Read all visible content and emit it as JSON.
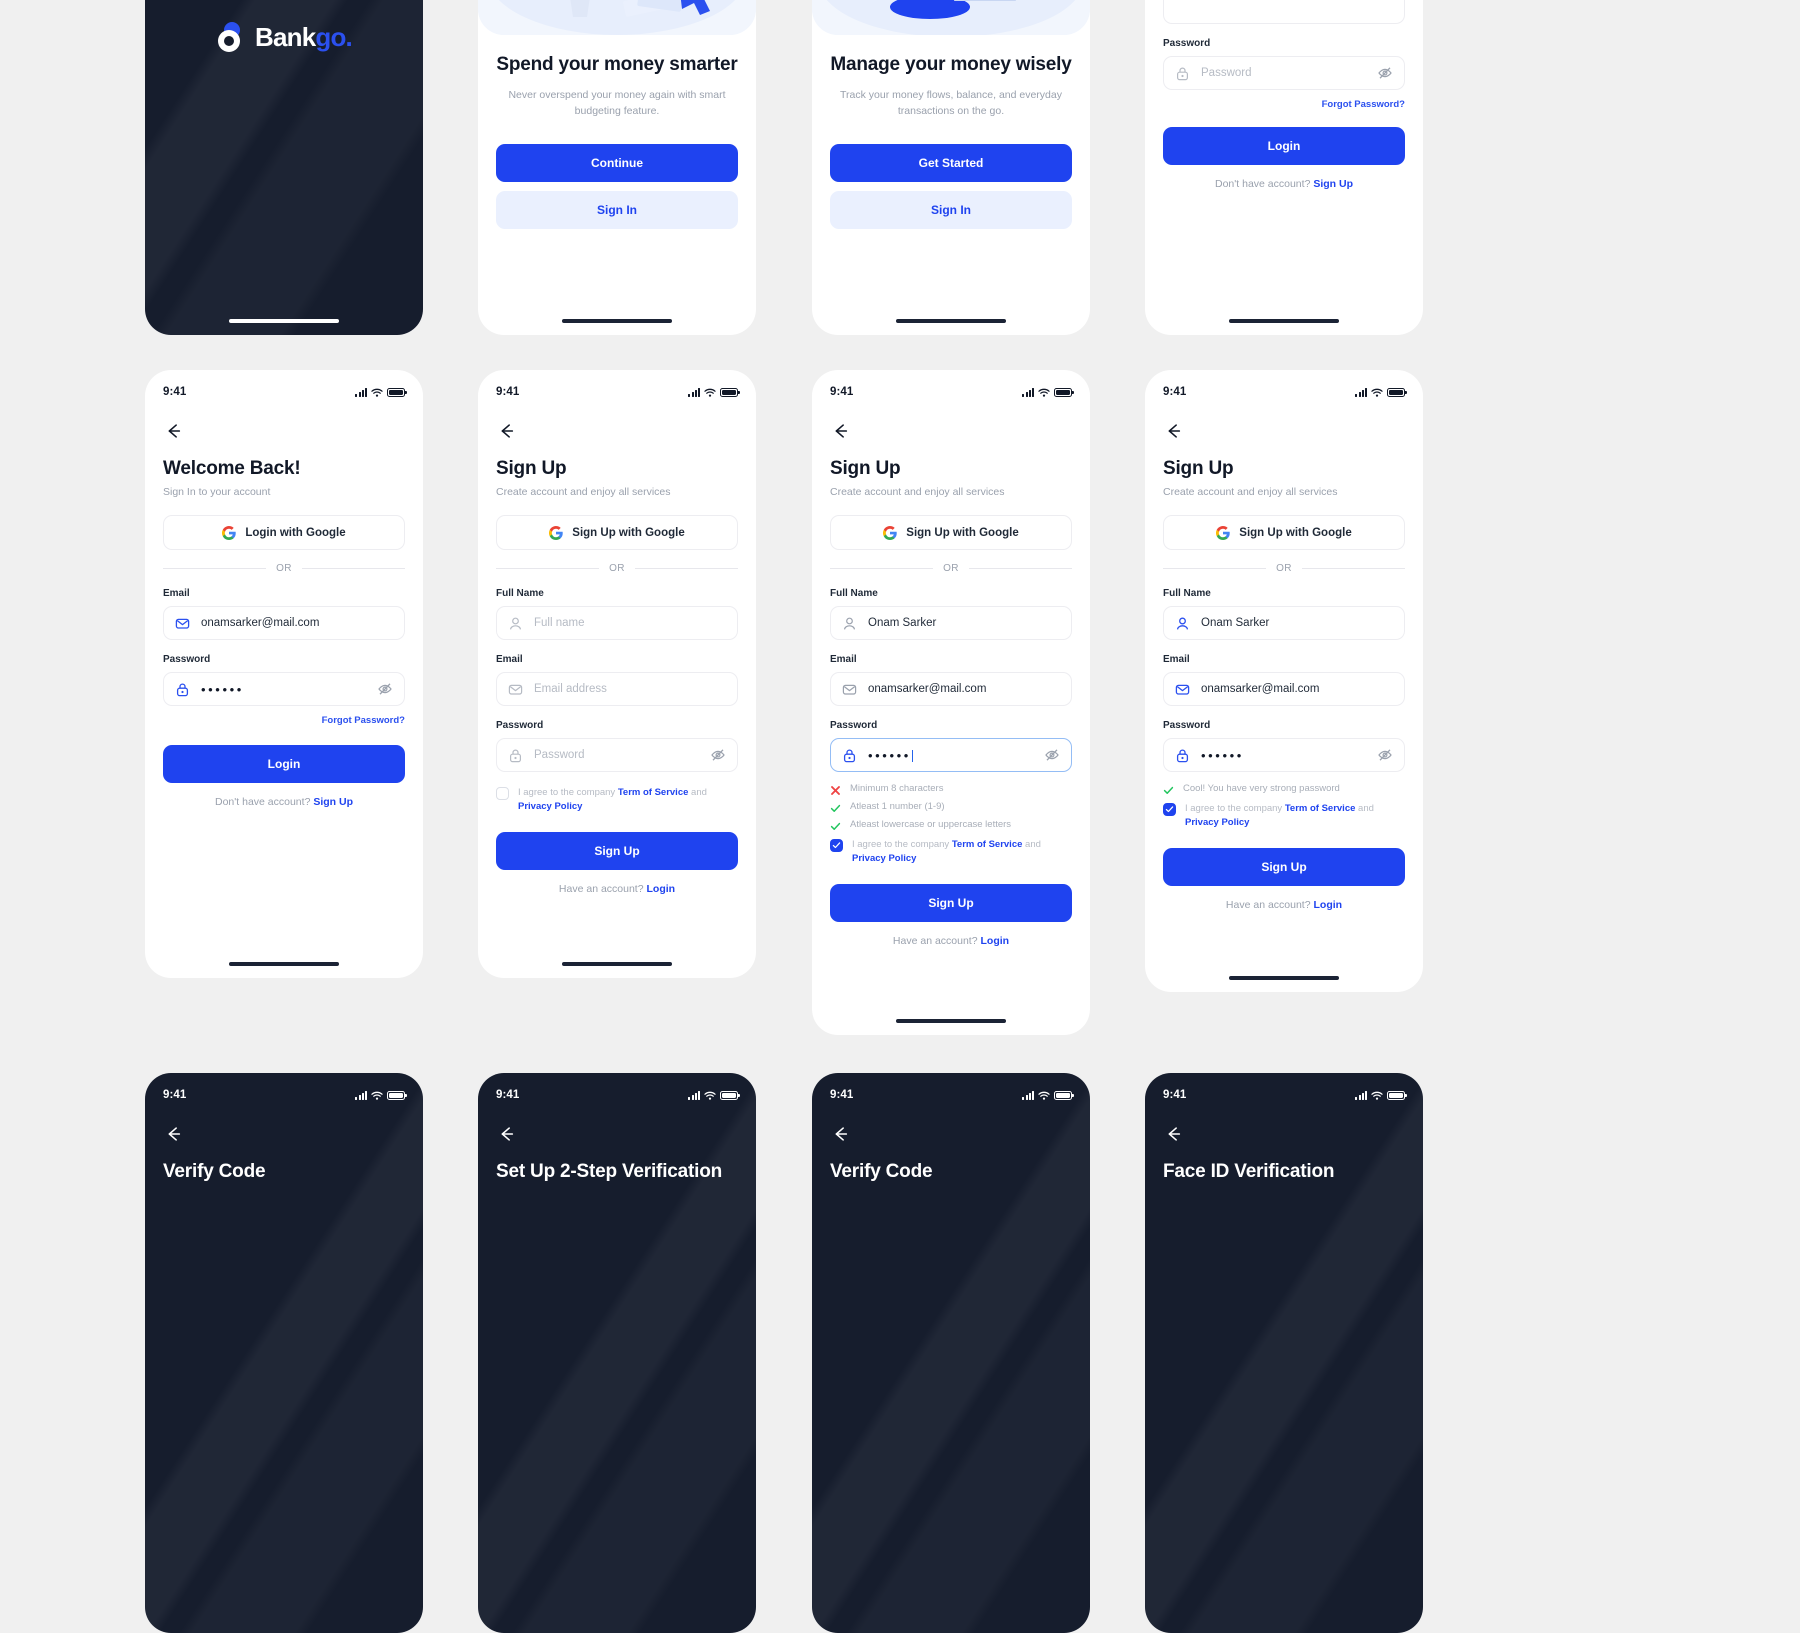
{
  "meta": {
    "background": "#f0f0f0",
    "accent": "#1f43ef",
    "accent_light": "#eaf0fe",
    "dark_bg": "#161d2d",
    "muted": "#9aa1ad",
    "status_time": "9:41"
  },
  "splash": {
    "logo_word_1": "Bank",
    "logo_word_2": "go."
  },
  "onboarding": [
    {
      "title": "Spend your money smarter",
      "subtitle": "Never overspend your money again with smart budgeting feature.",
      "primary": "Continue",
      "secondary": "Sign In"
    },
    {
      "title": "Manage your money wisely",
      "subtitle": "Track your money flows, balance, and everyday transactions on the go.",
      "primary": "Get Started",
      "secondary": "Sign In"
    }
  ],
  "login_partial": {
    "password_label": "Password",
    "password_placeholder": "Password",
    "forgot": "Forgot Password?",
    "login_button": "Login",
    "footer_text": "Don't have account?",
    "footer_link": "Sign Up"
  },
  "login": {
    "title": "Welcome Back!",
    "subtitle": "Sign In to your account",
    "google_button": "Login with Google",
    "divider": "OR",
    "email_label": "Email",
    "email_value": "onamsarker@mail.com",
    "email_placeholder": "Email address",
    "password_label": "Password",
    "password_value": "••••••",
    "forgot": "Forgot Password?",
    "login_button": "Login",
    "footer_text": "Don't have account?",
    "footer_link": "Sign Up"
  },
  "signup_empty": {
    "title": "Sign Up",
    "subtitle": "Create account and enjoy all services",
    "google_button": "Sign Up with Google",
    "divider": "OR",
    "name_label": "Full Name",
    "name_placeholder": "Full name",
    "email_label": "Email",
    "email_placeholder": "Email address",
    "password_label": "Password",
    "password_placeholder": "Password",
    "terms_pre": "I agree to the company",
    "terms_link_1": "Term of Service",
    "terms_and": "and",
    "terms_link_2": "Privacy Policy",
    "terms_checked": false,
    "signup_button": "Sign Up",
    "footer_text": "Have an account?",
    "footer_link": "Login"
  },
  "signup_validating": {
    "title": "Sign Up",
    "subtitle": "Create account and enjoy all services",
    "google_button": "Sign Up with Google",
    "divider": "OR",
    "name_label": "Full Name",
    "name_value": "Onam Sarker",
    "email_label": "Email",
    "email_value": "onamsarker@mail.com",
    "password_label": "Password",
    "password_value": "••••••",
    "rules": [
      {
        "text": "Minimum 8 characters",
        "state": "fail"
      },
      {
        "text": "Atleast 1 number (1-9)",
        "state": "pass"
      },
      {
        "text": "Atleast lowercase or uppercase letters",
        "state": "pass"
      }
    ],
    "terms_pre": "I agree to the company",
    "terms_link_1": "Term of Service",
    "terms_and": "and",
    "terms_link_2": "Privacy Policy",
    "terms_checked": true,
    "signup_button": "Sign Up",
    "footer_text": "Have an account?",
    "footer_link": "Login"
  },
  "signup_valid": {
    "title": "Sign Up",
    "subtitle": "Create account and enjoy all services",
    "google_button": "Sign Up with Google",
    "divider": "OR",
    "name_label": "Full Name",
    "name_value": "Onam Sarker",
    "email_label": "Email",
    "email_value": "onamsarker@mail.com",
    "password_label": "Password",
    "password_value": "••••••",
    "strength_message": "Cool! You have very strong password",
    "terms_pre": "I agree to the company",
    "terms_link_1": "Term of Service",
    "terms_and": "and",
    "terms_link_2": "Privacy Policy",
    "terms_checked": true,
    "signup_button": "Sign Up",
    "footer_text": "Have an account?",
    "footer_link": "Login"
  },
  "dark_screens": [
    {
      "title": "Verify Code"
    },
    {
      "title": "Set Up 2-Step Verification"
    },
    {
      "title": "Verify Code"
    },
    {
      "title": "Face ID Verification"
    }
  ],
  "icons": {
    "back": "arrow-left-icon",
    "google": "google-icon",
    "mail": "mail-icon",
    "lock": "lock-icon",
    "user": "user-icon",
    "eye_off": "eye-off-icon",
    "check": "check-icon",
    "cross": "cross-icon",
    "signal": "signal-icon",
    "wifi": "wifi-icon",
    "battery": "battery-icon"
  }
}
